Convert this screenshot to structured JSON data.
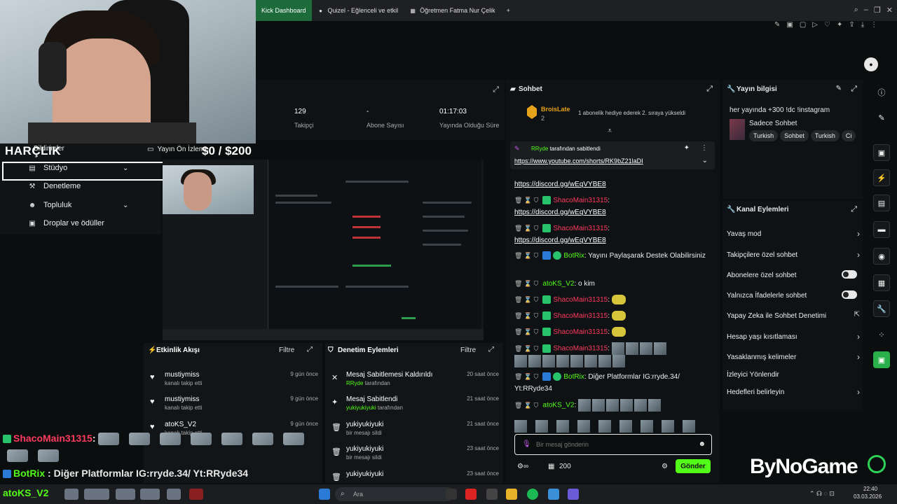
{
  "browser": {
    "tabs": [
      {
        "label": "Kick Dashboard"
      },
      {
        "label": "Quizel - Eğlenceli ve etkil"
      },
      {
        "label": "Öğretmen Fatma Nur Çelik"
      }
    ],
    "new_tab": "+"
  },
  "overlay": {
    "title": "HARÇLIK",
    "goal": "$0  / $200",
    "chat": [
      {
        "user": "ShacoMain31315",
        "sep": ":"
      },
      {
        "user": "BotRix",
        "sep": ":",
        "text": "Diğer Platformlar IG:rryde.34/ Yt:RRyde34"
      },
      {
        "user": "atoKS_V2",
        "sep": ":"
      }
    ]
  },
  "sidebar": {
    "items": [
      {
        "label": "Bildirimler"
      },
      {
        "label": "Stüdyo"
      },
      {
        "label": "Denetleme"
      },
      {
        "label": "Topluluk"
      },
      {
        "label": "Droplar ve ödüller"
      }
    ]
  },
  "preview": {
    "label": "Yayın Ön İzleme"
  },
  "stats": {
    "followers_value": "129",
    "followers_label": "Takipçi",
    "subs_value": "-",
    "subs_label": "Abone Sayısı",
    "duration_value": "01:17:03",
    "duration_label": "Yayında Olduğu Süre"
  },
  "activity": {
    "title": "Etkinlik Akışı",
    "filter": "Filtre",
    "items": [
      {
        "user": "mustiymiss",
        "desc": "kanalı takip etti",
        "time": "9 gün önce"
      },
      {
        "user": "mustiymiss",
        "desc": "kanalı takip etti",
        "time": "9 gün önce"
      },
      {
        "user": "atoKS_V2",
        "desc": "kanalı takip etti",
        "time": "9 gün önce"
      }
    ]
  },
  "moderation": {
    "title": "Denetim Eylemleri",
    "filter": "Filtre",
    "items": [
      {
        "title": "Mesaj Sabitlemesi Kaldırıldı",
        "actor": "RRyde",
        "suffix": "tarafından",
        "time": "20 saat önce"
      },
      {
        "title": "Mesaj Sabitlendi",
        "actor": "yukiyukiyuki",
        "suffix": "tarafından",
        "time": "21 saat önce"
      },
      {
        "title": "yukiyukiyuki",
        "actor": "",
        "suffix": "bir mesajı sildi",
        "time": "21 saat önce"
      },
      {
        "title": "yukiyukiyuki",
        "actor": "",
        "suffix": "bir mesajı sildi",
        "time": "23 saat önce"
      },
      {
        "title": "yukiyukiyuki",
        "actor": "",
        "suffix": "",
        "time": "23 saat önce"
      }
    ]
  },
  "chat": {
    "title": "Sohbet",
    "gifter": {
      "name": "BroisLate",
      "rank": "2",
      "text": "1 abonelik hediye ederek 2. sıraya yükseldi"
    },
    "pinned": {
      "by": "RRyde",
      "suffix": "tarafından sabitlendi",
      "link": "https://www.youtube.com/shorts/RK9bZ21laDI"
    },
    "messages": [
      {
        "user": "",
        "text": "https://discord.gg/wEqVYBE8"
      },
      {
        "user": "ShacoMain31315",
        "text": "https://discord.gg/wEqVYBE8"
      },
      {
        "user": "ShacoMain31315",
        "text": "https://discord.gg/wEqVYBE8"
      },
      {
        "user": "BotRix",
        "text": "Yayını Paylaşarak Destek Olabilirsiniz"
      },
      {
        "user": "atoKS_V2",
        "text": "o kim"
      },
      {
        "user": "ShacoMain31315",
        "text": ""
      },
      {
        "user": "ShacoMain31315",
        "text": ""
      },
      {
        "user": "ShacoMain31315",
        "text": ""
      },
      {
        "user": "ShacoMain31315",
        "text": ""
      },
      {
        "user": "BotRix",
        "text": "Diğer Platformlar IG:rryde.34/ Yt:RRyde34"
      },
      {
        "user": "atoKS_V2",
        "text": ""
      }
    ],
    "input_placeholder": "Bir mesaj gönderin",
    "points": "200",
    "send": "Gönder"
  },
  "stream_info": {
    "title": "Yayın bilgisi",
    "stream_title": "her yayında +300 !dc !instagram",
    "category": "Sadece Sohbet",
    "tags": [
      "Turkish",
      "Sohbet",
      "Turkish",
      "Ci"
    ]
  },
  "channel_actions": {
    "title": "Kanal Eylemleri",
    "options": [
      {
        "label": "Yavaş mod",
        "control": "chevron"
      },
      {
        "label": "Takipçilere özel sohbet",
        "control": "chevron"
      },
      {
        "label": "Abonelere özel sohbet",
        "control": "toggle"
      },
      {
        "label": "Yalnızca İfadelerle sohbet",
        "control": "toggle"
      },
      {
        "label": "Yapay Zeka ile Sohbet Denetimi",
        "control": "external"
      },
      {
        "label": "Hesap yaşı kısıtlaması",
        "control": "chevron"
      },
      {
        "label": "Yasaklanmış kelimeler",
        "control": "chevron"
      },
      {
        "label": "İzleyici Yönlendir",
        "control": "none"
      },
      {
        "label": "Hedefleri belirleyin",
        "control": "chevron"
      }
    ]
  },
  "watermark": "ByNoGame",
  "taskbar": {
    "search": "Ara",
    "time": "22:40",
    "date": "03.03.2026"
  },
  "colors": {
    "kick_green": "#53fc18",
    "red_name": "#ff3b5f",
    "panel_bg": "#0f1214"
  }
}
